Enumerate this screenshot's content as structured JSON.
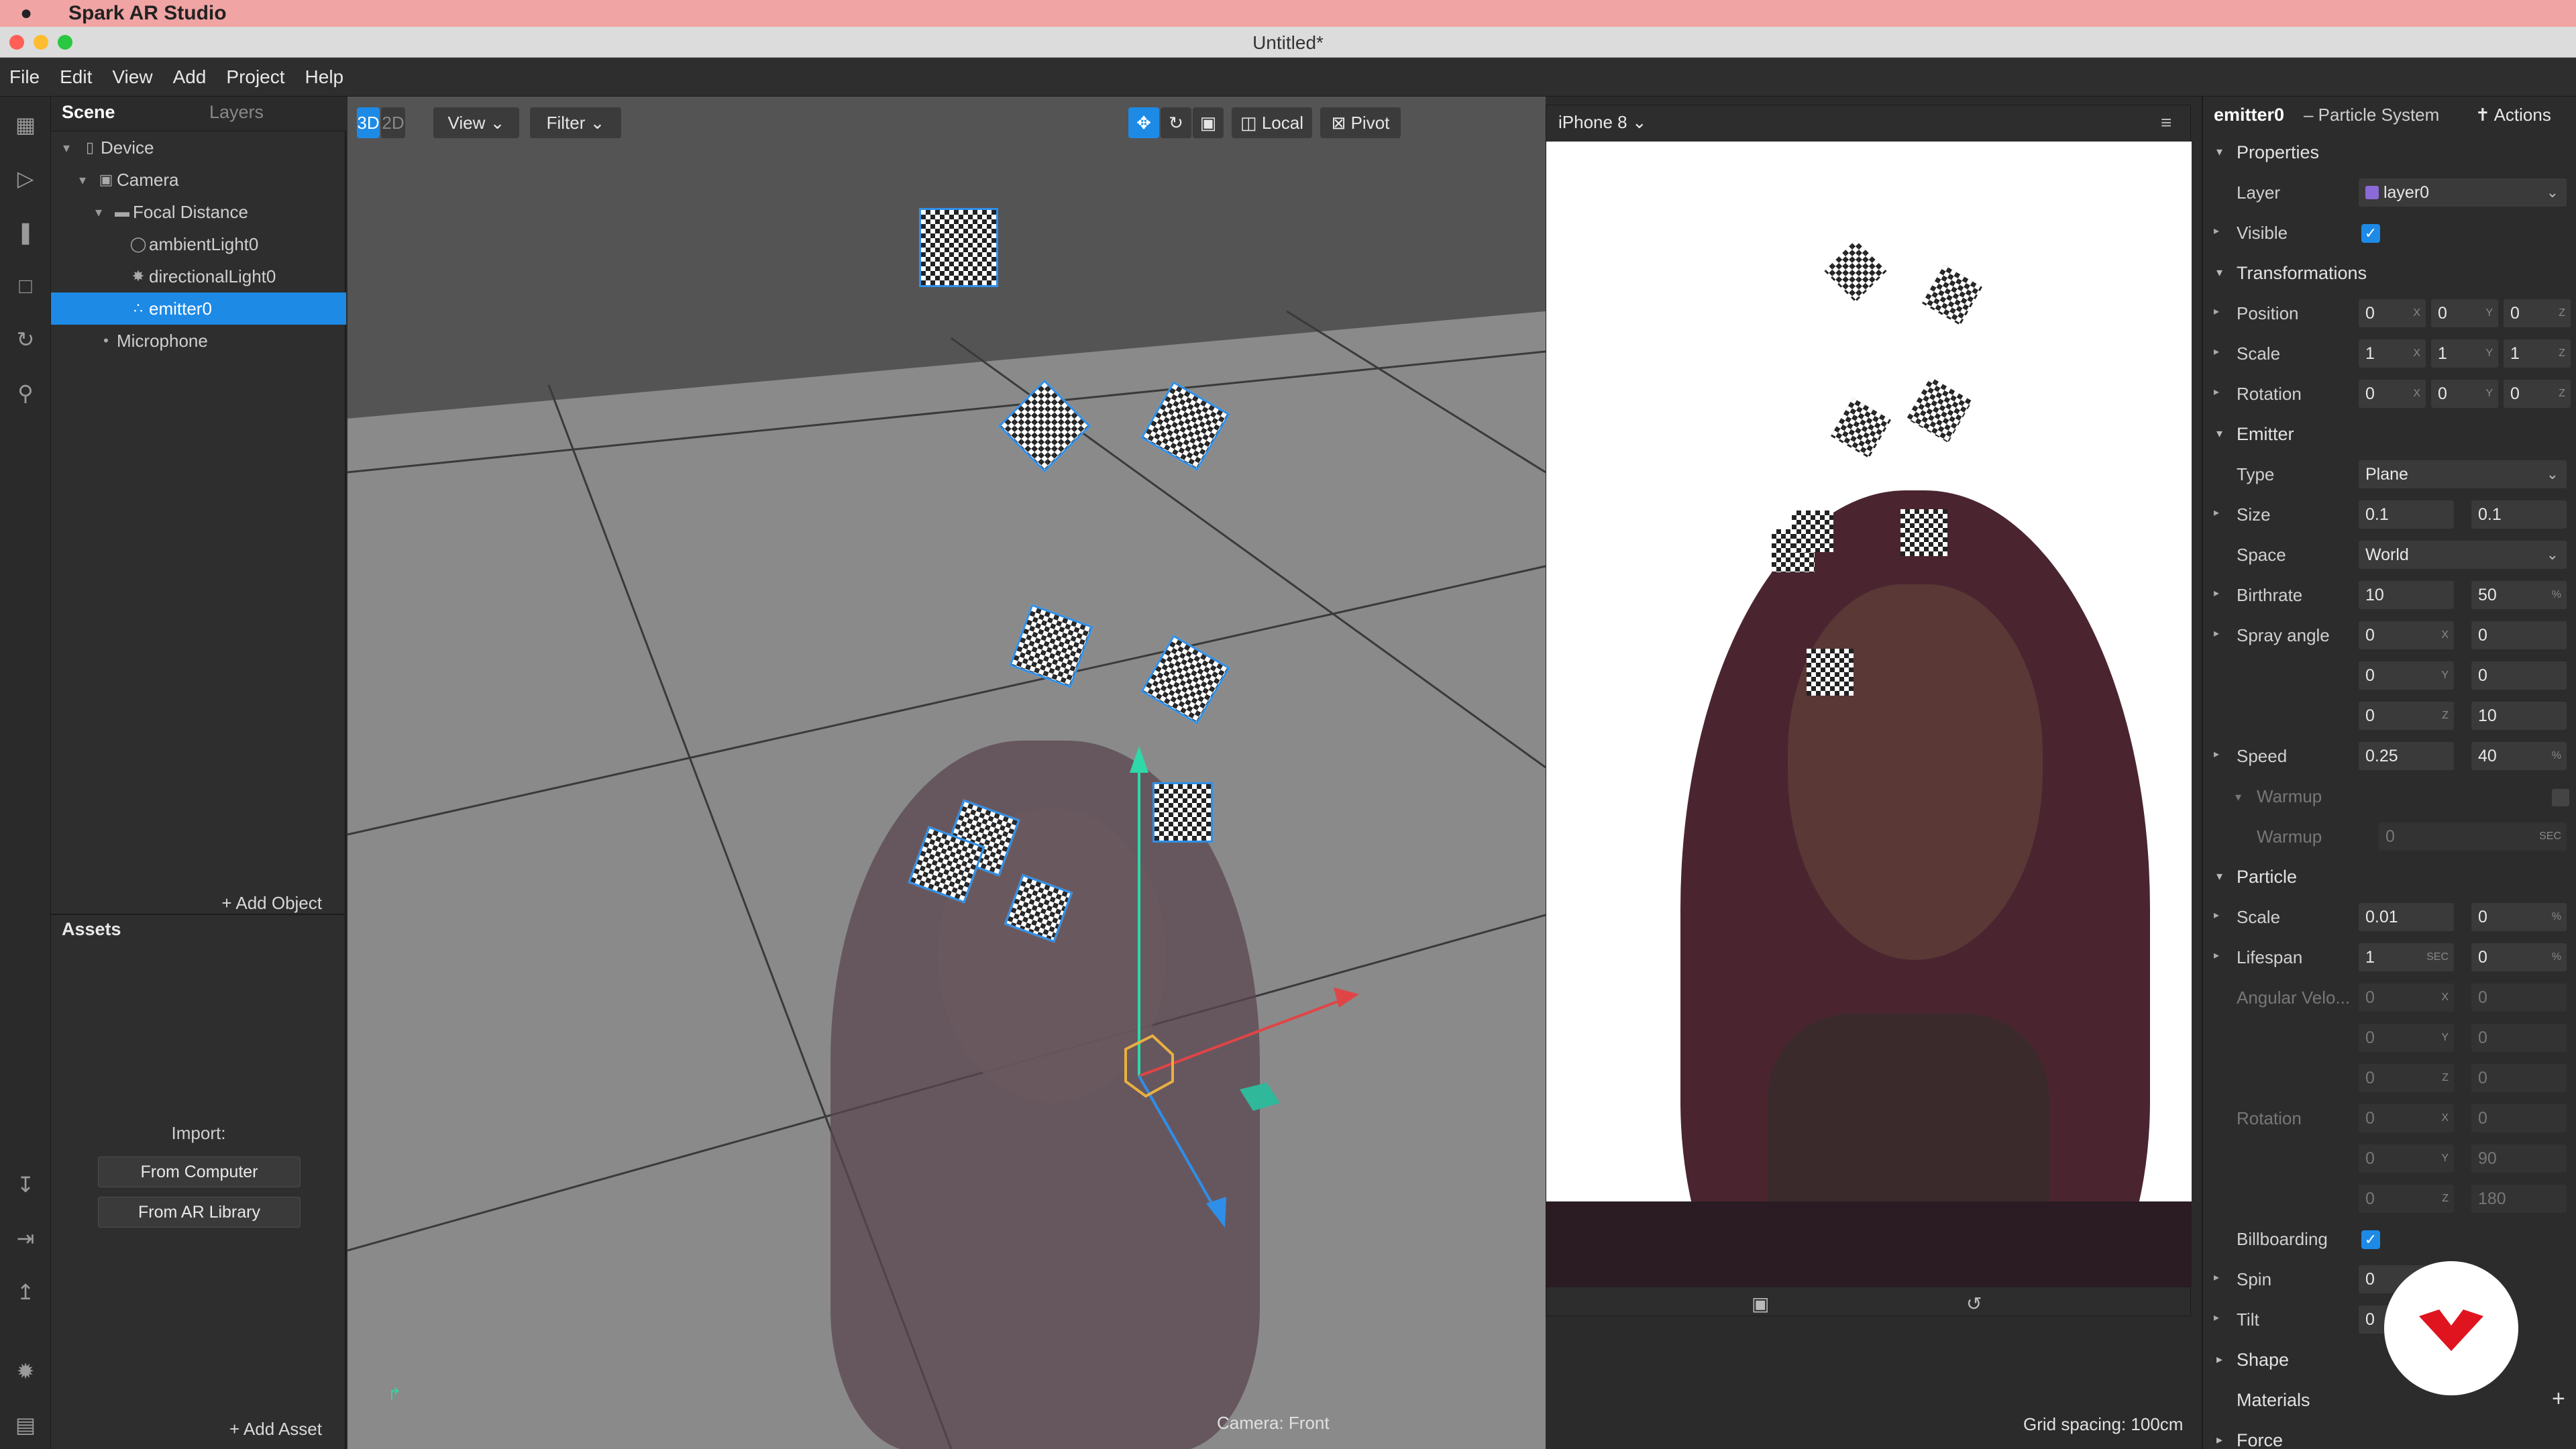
{
  "mac_menubar": {
    "app_name": "Spark AR Studio"
  },
  "window": {
    "title": "Untitled*"
  },
  "app_menu": [
    "File",
    "Edit",
    "View",
    "Add",
    "Project",
    "Help"
  ],
  "scene_panel": {
    "tabs": [
      "Scene",
      "Layers"
    ],
    "tree": [
      {
        "label": "Device"
      },
      {
        "label": "Camera"
      },
      {
        "label": "Focal Distance"
      },
      {
        "label": "ambientLight0"
      },
      {
        "label": "directionalLight0"
      },
      {
        "label": "emitter0"
      },
      {
        "label": "Microphone"
      }
    ],
    "add_object": "+ Add Object"
  },
  "assets_panel": {
    "title": "Assets",
    "import_label": "Import:",
    "from_computer": "From Computer",
    "from_ar_library": "From AR Library",
    "add_asset": "+ Add Asset"
  },
  "viewport": {
    "mode_3d": "3D",
    "mode_2d": "2D",
    "view_label": "View",
    "filter_label": "Filter",
    "local_label": "Local",
    "pivot_label": "Pivot",
    "camera_label": "Camera: Front",
    "grid_label": "Grid spacing: 100cm"
  },
  "preview": {
    "device": "iPhone 8"
  },
  "inspector": {
    "object_name": "emitter0",
    "object_type": "– Particle System",
    "actions_label": "Actions",
    "properties": {
      "title": "Properties",
      "layer_label": "Layer",
      "layer_value": "layer0",
      "visible_label": "Visible"
    },
    "transformations": {
      "title": "Transformations",
      "position_label": "Position",
      "position": [
        "0",
        "0",
        "0"
      ],
      "scale_label": "Scale",
      "scale": [
        "1",
        "1",
        "1"
      ],
      "rotation_label": "Rotation",
      "rotation": [
        "0",
        "0",
        "0"
      ],
      "axes": [
        "X",
        "Y",
        "Z"
      ]
    },
    "emitter": {
      "title": "Emitter",
      "type_label": "Type",
      "type_value": "Plane",
      "size_label": "Size",
      "size": [
        "0.1",
        "0.1"
      ],
      "space_label": "Space",
      "space_value": "World",
      "birthrate_label": "Birthrate",
      "birthrate": [
        "10",
        "50"
      ],
      "spray_label": "Spray angle",
      "spray_rows": [
        [
          "0",
          "0"
        ],
        [
          "0",
          "0"
        ],
        [
          "0",
          "10"
        ]
      ],
      "speed_label": "Speed",
      "speed": [
        "0.25",
        "40"
      ],
      "warmup_section": "Warmup",
      "warmup_label": "Warmup",
      "warmup_value": "0",
      "sec_unit": "SEC",
      "pct_unit": "%"
    },
    "particle": {
      "title": "Particle",
      "scale_label": "Scale",
      "scale": [
        "0.01",
        "0"
      ],
      "lifespan_label": "Lifespan",
      "lifespan": [
        "1",
        "0"
      ],
      "angular_label": "Angular Velo...",
      "angular_rows": [
        [
          "0",
          "0"
        ],
        [
          "0",
          "0"
        ],
        [
          "0",
          "0"
        ]
      ],
      "rotation_label": "Rotation",
      "rotation_rows": [
        [
          "0",
          "0"
        ],
        [
          "0",
          "90"
        ],
        [
          "0",
          "180"
        ]
      ],
      "billboarding_label": "Billboarding",
      "spin_label": "Spin",
      "spin_value": "0",
      "tilt_label": "Tilt",
      "tilt_value": "0"
    },
    "shape_label": "Shape",
    "materials_label": "Materials",
    "force_label": "Force"
  },
  "colors": {
    "accent": "#1d8ae6",
    "menubar": "#f0a4a4",
    "badge": "#e0141e"
  }
}
